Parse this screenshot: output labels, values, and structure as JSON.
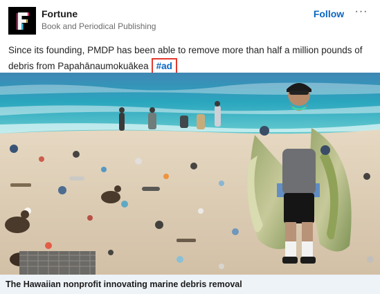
{
  "post": {
    "author": "Fortune",
    "author_subtitle": "Book and Periodical Publishing",
    "follow_label": "Follow",
    "more_label": "···",
    "text": "Since its founding, PMDP has been able to remove more than half a million pounds of debris from Papahānaumokuākea",
    "hashtag": "#ad"
  },
  "media": {
    "description_icon": "beach-cleanup-photo"
  },
  "article": {
    "title": "The Hawaiian nonprofit innovating marine debris removal"
  },
  "colors": {
    "accent": "#0a66c2",
    "highlight_border": "#e2392f",
    "caption_background": "#eef3f8"
  }
}
